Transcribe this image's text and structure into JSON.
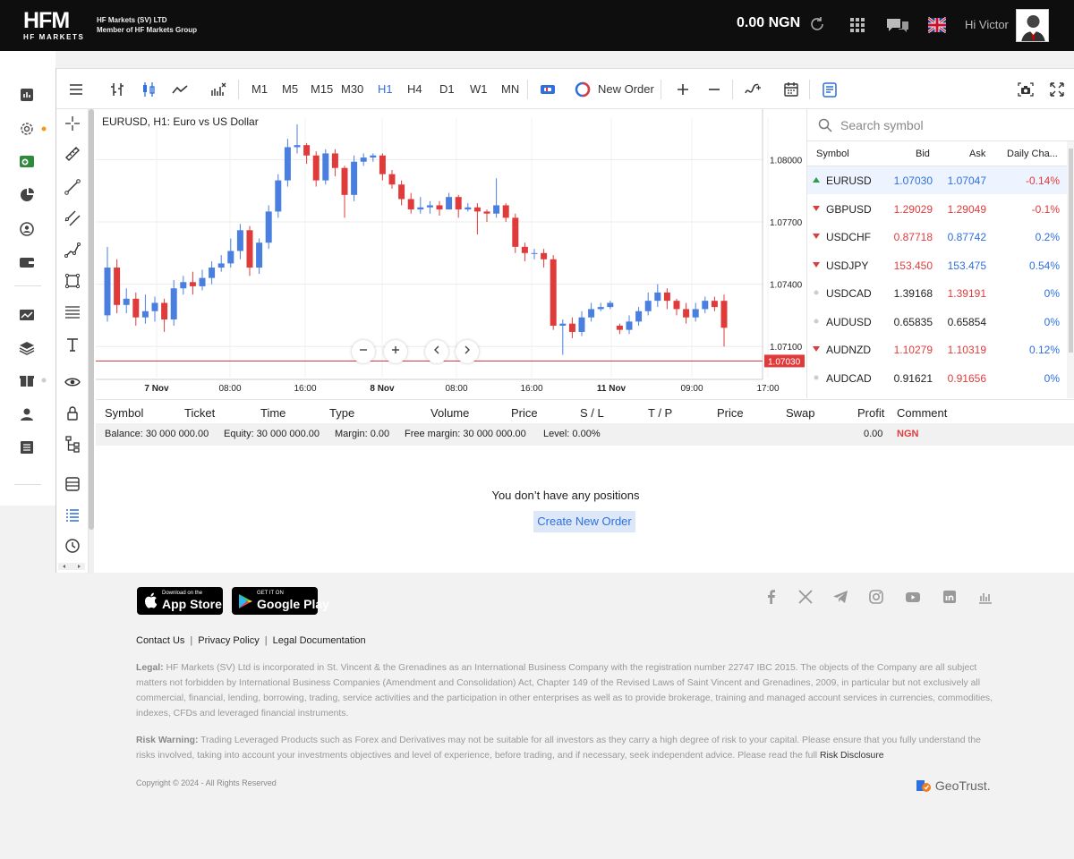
{
  "header": {
    "logo_text": "HFM",
    "logo_sub": "HF MARKETS",
    "company_line1": "HF Markets (SV) LTD",
    "company_line2": "Member of HF Markets Group",
    "balance": "0.00 NGN",
    "greeting": "Hi Victor"
  },
  "toolbar": {
    "timeframes": [
      "M1",
      "M5",
      "M15",
      "M30",
      "H1",
      "H4",
      "D1",
      "W1",
      "MN"
    ],
    "active_timeframe": "H1",
    "new_order": "New Order"
  },
  "chart": {
    "title": "EURUSD, H1: Euro vs US Dollar",
    "current_price": "1.07030",
    "accent_bull": "#4a7fe0",
    "accent_bear": "#e03b3b",
    "price_ticks": [
      "1.08000",
      "1.07700",
      "1.07400",
      "1.07100"
    ],
    "time_ticks": [
      "7 Nov",
      "08:00",
      "16:00",
      "8 Nov",
      "08:00",
      "16:00",
      "11 Nov",
      "09:00",
      "17:00"
    ]
  },
  "chart_data": {
    "type": "candlestick",
    "symbol": "EURUSD",
    "timeframe": "H1",
    "ylim": [
      1.0695,
      1.082
    ],
    "candles": [
      [
        1.0725,
        1.0748,
        1.0758,
        1.0722
      ],
      [
        1.0748,
        1.073,
        1.0752,
        1.0726
      ],
      [
        1.073,
        1.0733,
        1.0738,
        1.0726
      ],
      [
        1.0733,
        1.0724,
        1.0736,
        1.072
      ],
      [
        1.0724,
        1.0727,
        1.0735,
        1.0721
      ],
      [
        1.0727,
        1.0731,
        1.0734,
        1.0722
      ],
      [
        1.0731,
        1.0723,
        1.0733,
        1.0717
      ],
      [
        1.0723,
        1.0738,
        1.0742,
        1.072
      ],
      [
        1.0738,
        1.0741,
        1.0744,
        1.0735
      ],
      [
        1.0741,
        1.0739,
        1.0746,
        1.0735
      ],
      [
        1.0739,
        1.0743,
        1.0747,
        1.0737
      ],
      [
        1.0743,
        1.0748,
        1.0751,
        1.074
      ],
      [
        1.0748,
        1.075,
        1.0754,
        1.0746
      ],
      [
        1.075,
        1.0756,
        1.0762,
        1.0748
      ],
      [
        1.0756,
        1.0766,
        1.0769,
        1.0752
      ],
      [
        1.0766,
        1.0748,
        1.0768,
        1.0744
      ],
      [
        1.0748,
        1.076,
        1.0762,
        1.0745
      ],
      [
        1.076,
        1.0775,
        1.0778,
        1.0757
      ],
      [
        1.0775,
        1.079,
        1.0793,
        1.0772
      ],
      [
        1.079,
        1.0806,
        1.081,
        1.0787
      ],
      [
        1.0806,
        1.0807,
        1.0817,
        1.0803
      ],
      [
        1.0807,
        1.0802,
        1.0808,
        1.0798
      ],
      [
        1.0802,
        1.079,
        1.0804,
        1.0787
      ],
      [
        1.079,
        1.0803,
        1.0805,
        1.0788
      ],
      [
        1.0803,
        1.0796,
        1.0805,
        1.0792
      ],
      [
        1.0796,
        1.0783,
        1.0797,
        1.0772
      ],
      [
        1.0783,
        1.0799,
        1.0802,
        1.078
      ],
      [
        1.0799,
        1.0801,
        1.0803,
        1.0797
      ],
      [
        1.0801,
        1.0802,
        1.0803,
        1.0799
      ],
      [
        1.0802,
        1.0793,
        1.0803,
        1.079
      ],
      [
        1.0793,
        1.0788,
        1.0795,
        1.0786
      ],
      [
        1.0788,
        1.0781,
        1.079,
        1.0778
      ],
      [
        1.0781,
        1.0776,
        1.0784,
        1.0774
      ],
      [
        1.0776,
        1.0777,
        1.0782,
        1.0774
      ],
      [
        1.0777,
        1.0778,
        1.078,
        1.0774
      ],
      [
        1.0778,
        1.0776,
        1.078,
        1.0773
      ],
      [
        1.0776,
        1.0782,
        1.0784,
        1.0776
      ],
      [
        1.0782,
        1.0776,
        1.0783,
        1.0772
      ],
      [
        1.0776,
        1.0777,
        1.0779,
        1.0775
      ],
      [
        1.0777,
        1.0775,
        1.0779,
        1.0764
      ],
      [
        1.0775,
        1.0774,
        1.0776,
        1.077
      ],
      [
        1.0774,
        1.0778,
        1.0791,
        1.0772
      ],
      [
        1.0778,
        1.0772,
        1.0779,
        1.077
      ],
      [
        1.0772,
        1.0758,
        1.0774,
        1.0755
      ],
      [
        1.0758,
        1.0755,
        1.076,
        1.0751
      ],
      [
        1.0755,
        1.0755,
        1.0757,
        1.0752
      ],
      [
        1.0755,
        1.0752,
        1.0757,
        1.0748
      ],
      [
        1.0752,
        1.072,
        1.0754,
        1.0718
      ],
      [
        1.072,
        1.0721,
        1.0723,
        1.0706
      ],
      [
        1.0721,
        1.0717,
        1.0724,
        1.0714
      ],
      [
        1.0717,
        1.0724,
        1.0727,
        1.0715
      ],
      [
        1.0724,
        1.0728,
        1.0731,
        1.0722
      ],
      [
        1.0728,
        1.0729,
        1.0731,
        1.0727
      ],
      [
        1.0729,
        1.0731,
        1.0732,
        1.0728
      ],
      [
        1.072,
        1.0718,
        1.0721,
        1.0716
      ],
      [
        1.0718,
        1.0722,
        1.0725,
        1.0716
      ],
      [
        1.0722,
        1.0727,
        1.0729,
        1.072
      ],
      [
        1.0727,
        1.0732,
        1.0736,
        1.0725
      ],
      [
        1.0732,
        1.0736,
        1.074,
        1.0729
      ],
      [
        1.0736,
        1.0732,
        1.0738,
        1.0728
      ],
      [
        1.0732,
        1.0728,
        1.0733,
        1.0725
      ],
      [
        1.0728,
        1.0724,
        1.0731,
        1.0721
      ],
      [
        1.0724,
        1.0728,
        1.0731,
        1.0722
      ],
      [
        1.0728,
        1.0732,
        1.0734,
        1.0726
      ],
      [
        1.0732,
        1.0729,
        1.0734,
        1.0727
      ],
      [
        1.0732,
        1.0719,
        1.0735,
        1.071
      ]
    ]
  },
  "market_watch": {
    "search_placeholder": "Search symbol",
    "columns": [
      "Symbol",
      "Bid",
      "Ask",
      "Daily Cha..."
    ],
    "rows": [
      {
        "symbol": "EURUSD",
        "bid": "1.07030",
        "ask": "1.07047",
        "change": "-0.14%",
        "dir": "up",
        "bid_color": "#2f6fde",
        "ask_color": "#2f6fde",
        "chg_color": "#e03b3b"
      },
      {
        "symbol": "GBPUSD",
        "bid": "1.29029",
        "ask": "1.29049",
        "change": "-0.1%",
        "dir": "down",
        "bid_color": "#e03b3b",
        "ask_color": "#e03b3b",
        "chg_color": "#e03b3b"
      },
      {
        "symbol": "USDCHF",
        "bid": "0.87718",
        "ask": "0.87742",
        "change": "0.2%",
        "dir": "down",
        "bid_color": "#e03b3b",
        "ask_color": "#2f6fde",
        "chg_color": "#2f6fde"
      },
      {
        "symbol": "USDJPY",
        "bid": "153.450",
        "ask": "153.475",
        "change": "0.54%",
        "dir": "down",
        "bid_color": "#e03b3b",
        "ask_color": "#2f6fde",
        "chg_color": "#2f6fde"
      },
      {
        "symbol": "USDCAD",
        "bid": "1.39168",
        "ask": "1.39191",
        "change": "0%",
        "dir": "none",
        "bid_color": "#222222",
        "ask_color": "#e03b3b",
        "chg_color": "#2f6fde"
      },
      {
        "symbol": "AUDUSD",
        "bid": "0.65835",
        "ask": "0.65854",
        "change": "0%",
        "dir": "none",
        "bid_color": "#222222",
        "ask_color": "#222222",
        "chg_color": "#2f6fde"
      },
      {
        "symbol": "AUDNZD",
        "bid": "1.10279",
        "ask": "1.10319",
        "change": "0.12%",
        "dir": "down",
        "bid_color": "#e03b3b",
        "ask_color": "#e03b3b",
        "chg_color": "#2f6fde"
      },
      {
        "symbol": "AUDCAD",
        "bid": "0.91621",
        "ask": "0.91656",
        "change": "0%",
        "dir": "none",
        "bid_color": "#222222",
        "ask_color": "#e03b3b",
        "chg_color": "#2f6fde"
      }
    ]
  },
  "positions": {
    "columns": [
      "Symbol",
      "Ticket",
      "Time",
      "Type",
      "Volume",
      "Price",
      "S / L",
      "T / P",
      "Price",
      "Swap",
      "Profit",
      "Comment"
    ],
    "balance": "Balance: 30 000 000.00",
    "equity": "Equity: 30 000 000.00",
    "margin": "Margin: 0.00",
    "free_margin": "Free margin: 30 000 000.00",
    "level": "Level: 0.00%",
    "profit": "0.00",
    "currency": "NGN",
    "empty_message": "You don’t have any positions",
    "create_button": "Create New Order"
  },
  "footer": {
    "app_store_small": "Download on the",
    "app_store": "App Store",
    "google_small": "GET IT ON",
    "google_play": "Google Play",
    "links": [
      "Contact Us",
      "Privacy Policy",
      "Legal Documentation"
    ],
    "legal_label": "Legal:",
    "legal_text": "HF Markets (SV) Ltd is incorporated in St. Vincent & the Grenadines as an International Business Company with the registration number 22747 IBC 2015. The objects of the Company are all subject matters not forbidden by International Business Companies (Amendment and Consolidation) Act, Chapter 149 of the Revised Laws of Saint Vincent and Grenadines, 2009, in particular but not exclusively all commercial, financial, lending, borrowing, trading, service activities and the participation in other enterprises as well as to provide brokerage, training and managed account services in currencies, commodities, indexes, CFDs and leveraged financial instruments.",
    "risk_label": "Risk Warning:",
    "risk_text": "Trading Leveraged Products such as Forex and Derivatives may not be suitable for all investors as they carry a high degree of risk to your capital. Please ensure that you fully understand the risks involved, taking into account your investments objectives and level of experience, before trading, and if necessary, seek independent advice. Please read the full",
    "risk_link": "Risk Disclosure",
    "copyright": "Copyright © 2024 - All Rights Reserved",
    "geotrust": "GeoTrust."
  }
}
